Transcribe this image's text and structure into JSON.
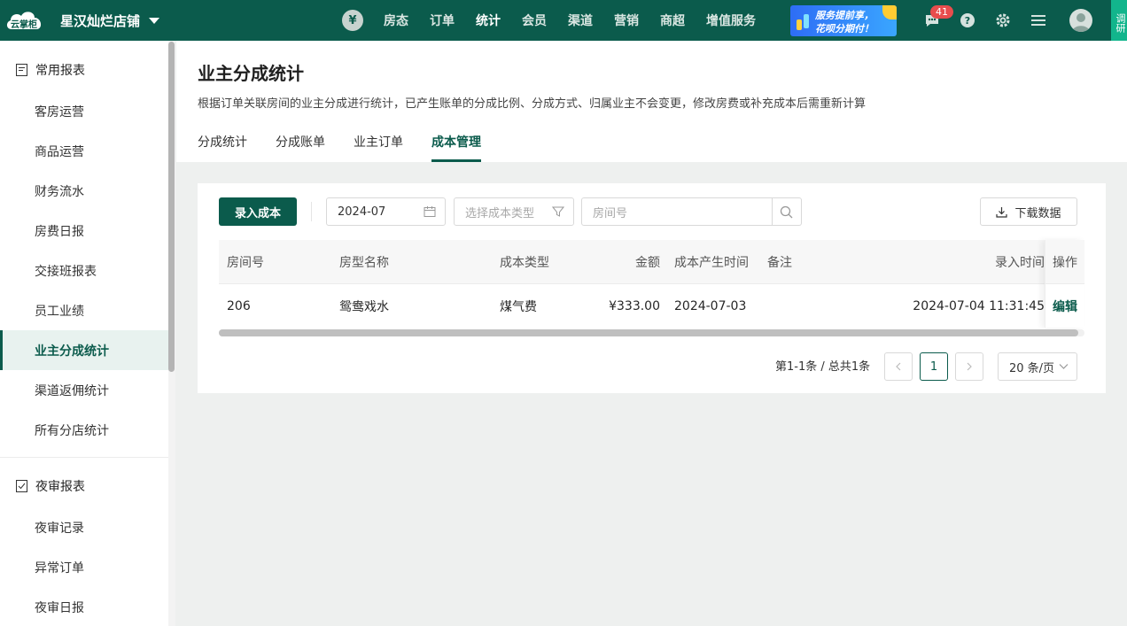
{
  "topbar": {
    "logo_text": "云掌柜",
    "store_name": "星汉灿烂店铺",
    "currency_symbol": "¥",
    "nav": [
      "房态",
      "订单",
      "统计",
      "会员",
      "渠道",
      "营销",
      "商超",
      "增值服务"
    ],
    "active_nav": "统计",
    "promo_line1": "服务提前享，",
    "promo_line2": "花呗分期付！",
    "message_count": "41",
    "survey_label": "调研"
  },
  "sidebar": {
    "groups": [
      {
        "label": "常用报表",
        "items": [
          "客房运营",
          "商品运营",
          "财务流水",
          "房费日报",
          "交接班报表",
          "员工业绩",
          "业主分成统计",
          "渠道返佣统计",
          "所有分店统计"
        ]
      },
      {
        "label": "夜审报表",
        "items": [
          "夜审记录",
          "异常订单",
          "夜审日报"
        ]
      }
    ],
    "active_item": "业主分成统计"
  },
  "header": {
    "title": "业主分成统计",
    "description": "根据订单关联房间的业主分成进行统计，已产生账单的分成比例、分成方式、归属业主不会变更，修改房费或补充成本后需重新计算",
    "tabs": [
      "分成统计",
      "分成账单",
      "业主订单",
      "成本管理"
    ],
    "active_tab": "成本管理"
  },
  "toolbar": {
    "add_cost_label": "录入成本",
    "month_value": "2024-07",
    "cost_type_placeholder": "选择成本类型",
    "room_placeholder": "房间号",
    "download_label": "下载数据"
  },
  "table": {
    "columns": [
      "房间号",
      "房型名称",
      "成本类型",
      "金额",
      "成本产生时间",
      "备注",
      "录入时间",
      "操作"
    ],
    "rows": [
      {
        "room": "206",
        "room_type": "鸳鸯戏水",
        "cost_type": "煤气费",
        "amount": "¥333.00",
        "cost_date": "2024-07-03",
        "note": "",
        "entry_time": "2024-07-04 11:31:45",
        "action": "编辑"
      }
    ]
  },
  "pagination": {
    "summary": "第1-1条 / 总共1条",
    "current_page": "1",
    "page_size": "20 条/页"
  },
  "colors": {
    "brand": "#0b5b4c",
    "badge": "#e84d4d",
    "survey": "#12b58c"
  }
}
